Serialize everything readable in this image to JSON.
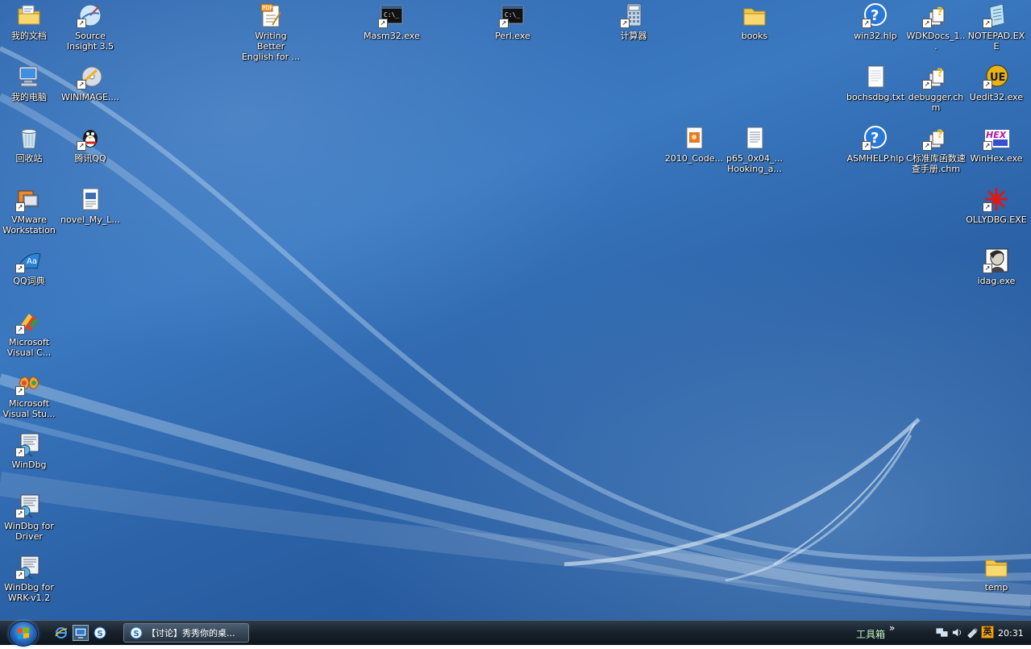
{
  "desktop_icons": {
    "my_documents": {
      "label": "我的文档",
      "icon": "folder-documents-icon"
    },
    "source_insight": {
      "label": "Source Insight 3.5",
      "icon": "source-insight-icon"
    },
    "writing_better": {
      "label": "Writing Better English for ...",
      "icon": "pdf-document-icon"
    },
    "masm32": {
      "label": "Masm32.exe",
      "icon": "console-icon"
    },
    "perl": {
      "label": "Perl.exe",
      "icon": "console-icon"
    },
    "calculator": {
      "label": "计算器",
      "icon": "calculator-icon"
    },
    "books": {
      "label": "books",
      "icon": "folder-icon"
    },
    "win32hlp": {
      "label": "win32.hlp",
      "icon": "help-icon"
    },
    "wdkdocs": {
      "label": "WDKDocs_1...",
      "icon": "chm-help-icon"
    },
    "notepad": {
      "label": "NOTEPAD.EXE",
      "icon": "notepad-icon"
    },
    "my_computer": {
      "label": "我的电脑",
      "icon": "computer-icon"
    },
    "winimage": {
      "label": "WINIMAGE....",
      "icon": "disc-icon"
    },
    "bochsdbg": {
      "label": "bochsdbg.txt",
      "icon": "text-file-icon"
    },
    "debugger_chm": {
      "label": "debugger.chm",
      "icon": "chm-help-icon"
    },
    "uedit32": {
      "label": "Uedit32.exe",
      "icon": "ultraedit-icon"
    },
    "recycle_bin": {
      "label": "回收站",
      "icon": "recycle-bin-icon"
    },
    "tencent_qq": {
      "label": "腾讯QQ",
      "icon": "qq-penguin-icon"
    },
    "code_2010": {
      "label": "2010_Code...",
      "icon": "image-file-icon"
    },
    "p65_hooking": {
      "label": "p65_0x04_... Hooking_a...",
      "icon": "text-file-icon"
    },
    "asmhelp": {
      "label": "ASMHELP.hlp",
      "icon": "help-icon"
    },
    "c_lib_manual": {
      "label": "C标准库函数速查手册.chm",
      "icon": "chm-help-icon"
    },
    "winhex": {
      "label": "WinHex.exe",
      "icon": "winhex-icon"
    },
    "vmware": {
      "label": "VMware Workstation",
      "icon": "vmware-icon"
    },
    "novel": {
      "label": "novel_My_L...",
      "icon": "document-icon"
    },
    "ollydbg": {
      "label": "OLLYDBG.EXE",
      "icon": "ollydbg-bug-icon"
    },
    "qq_dict": {
      "label": "QQ词典",
      "icon": "dictionary-icon"
    },
    "idag": {
      "label": "idag.exe",
      "icon": "ida-icon"
    },
    "ms_visual_c": {
      "label": "Microsoft Visual C...",
      "icon": "visual-c-icon"
    },
    "ms_visual_studio": {
      "label": "Microsoft Visual Stu...",
      "icon": "visual-studio-icon"
    },
    "windbg": {
      "label": "WinDbg",
      "icon": "windbg-icon"
    },
    "windbg_driver": {
      "label": "WinDbg for Driver",
      "icon": "windbg-icon"
    },
    "windbg_wrk": {
      "label": "WinDbg for WRK-v1.2",
      "icon": "windbg-icon"
    },
    "temp": {
      "label": "temp",
      "icon": "folder-icon"
    }
  },
  "taskbar": {
    "task_button_label": "【讨论】秀秀你的桌...",
    "toolbox_label": "工具箱",
    "toolbox_chevron": "»",
    "clock": "20:31",
    "ime_label": "英"
  },
  "colors": {
    "desktop_blue": "#2f66ad",
    "taskbar_dark": "#18222c",
    "label_text": "#ffffff",
    "toolbox_green": "#bff7bf"
  }
}
